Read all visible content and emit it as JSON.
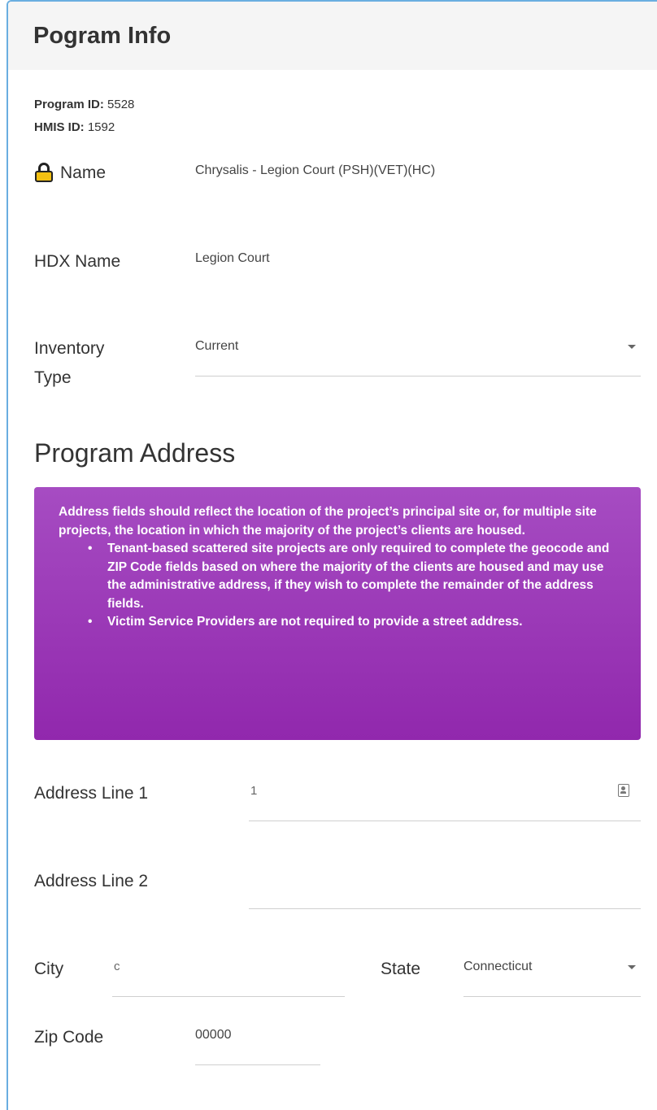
{
  "header": {
    "title": "Pogram Info"
  },
  "ids": {
    "program_id_label": "Program ID:",
    "program_id_value": "5528",
    "hmis_id_label": "HMIS ID:",
    "hmis_id_value": "1592"
  },
  "fields": {
    "name": {
      "label": "Name",
      "value": "Chrysalis - Legion Court (PSH)(VET)(HC)"
    },
    "hdx_name": {
      "label": "HDX Name",
      "value": "Legion Court"
    },
    "inventory_type": {
      "label_line1": "Inventory",
      "label_line2": "Type",
      "value": "Current"
    }
  },
  "address": {
    "section_title": "Program Address",
    "info": {
      "intro": "Address fields should reflect the location of the project’s principal site or, for multiple site projects, the location in which the majority of the project’s clients are housed.",
      "bullets": [
        "Tenant-based scattered site projects are only required to complete the geocode and ZIP Code fields based on where the majority of the clients are housed and may use the administrative address, if they wish to complete the remainder of the address fields.",
        "Victim Service Providers are not required to provide a street address."
      ]
    },
    "line1": {
      "label": "Address Line 1",
      "value": "1"
    },
    "line2": {
      "label": "Address Line 2",
      "value": ""
    },
    "city": {
      "label": "City",
      "value": "c"
    },
    "state": {
      "label": "State",
      "value": "Connecticut"
    },
    "zip": {
      "label": "Zip Code",
      "value": "00000"
    }
  },
  "icons": {
    "lock": "lock-icon",
    "dropdown": "chevron-down-icon",
    "contact": "contact-card-icon"
  },
  "colors": {
    "card_border": "#6aaee0",
    "info_box": "#9b35b5",
    "lock_fill": "#f3c012"
  }
}
